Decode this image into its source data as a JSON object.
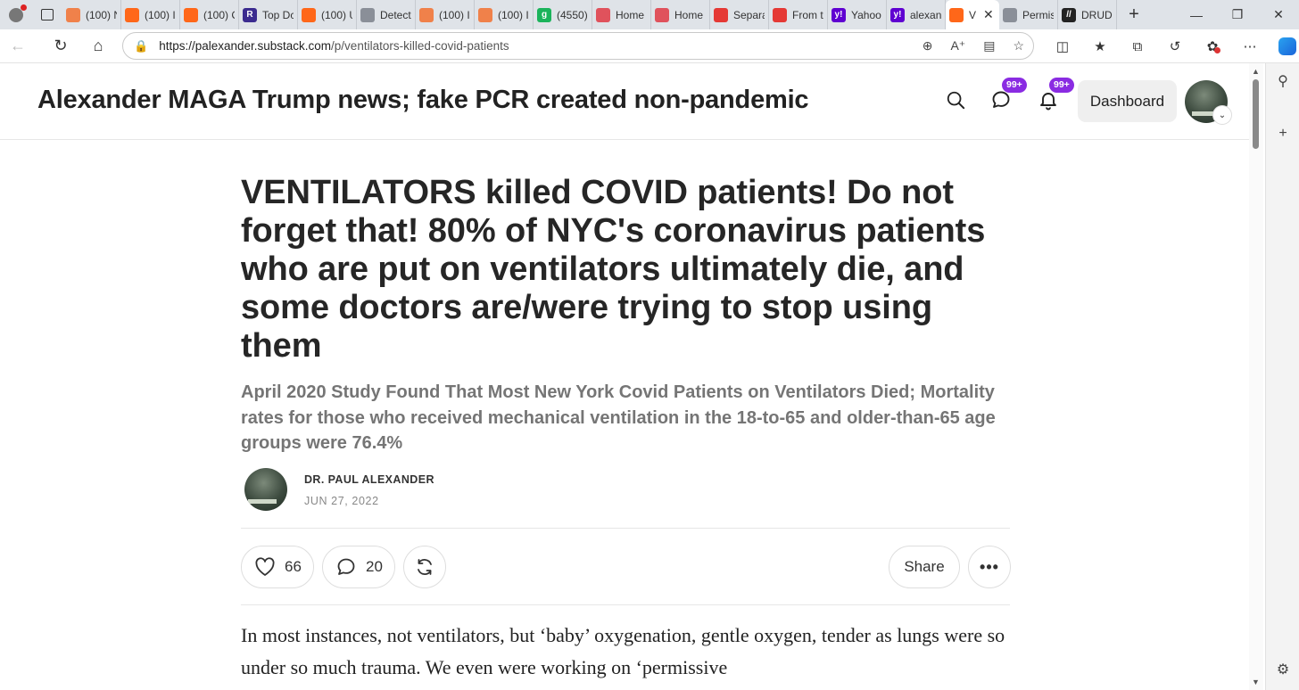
{
  "browser": {
    "tabs": [
      {
        "label": "(100) N",
        "color": "#f0814a",
        "glyph": ""
      },
      {
        "label": "(100) I",
        "color": "#ff6719",
        "glyph": ""
      },
      {
        "label": "(100) C",
        "color": "#ff6719",
        "glyph": ""
      },
      {
        "label": "Top Dc",
        "color": "#3b2b8f",
        "glyph": "R"
      },
      {
        "label": "(100) U",
        "color": "#ff6719",
        "glyph": ""
      },
      {
        "label": "Detect",
        "color": "#8a8f98",
        "glyph": ""
      },
      {
        "label": "(100) I",
        "color": "#f0814a",
        "glyph": ""
      },
      {
        "label": "(100) I",
        "color": "#f0814a",
        "glyph": ""
      },
      {
        "label": "(4550)",
        "color": "#1bb35b",
        "glyph": "g"
      },
      {
        "label": "Home",
        "color": "#e0525c",
        "glyph": ""
      },
      {
        "label": "Home",
        "color": "#e0525c",
        "glyph": ""
      },
      {
        "label": "Separa",
        "color": "#e53935",
        "glyph": ""
      },
      {
        "label": "From t",
        "color": "#e53935",
        "glyph": ""
      },
      {
        "label": "Yahoo",
        "color": "#5f01d1",
        "glyph": "y!"
      },
      {
        "label": "alexan",
        "color": "#5f01d1",
        "glyph": "y!"
      },
      {
        "label": "V",
        "color": "#ff6719",
        "glyph": "",
        "active": true
      },
      {
        "label": "Permis",
        "color": "#8a8f98",
        "glyph": ""
      },
      {
        "label": "DRUD",
        "color": "#222222",
        "glyph": "//"
      }
    ],
    "new_tab_label": "+",
    "url_host": "https://palexander.substack.com",
    "url_path": "/p/ventilators-killed-covid-patients"
  },
  "header": {
    "pub_title": "Alexander MAGA Trump news; fake PCR created non-pandemic",
    "chat_badge": "99+",
    "notif_badge": "99+",
    "dashboard_label": "Dashboard"
  },
  "post": {
    "title": "VENTILATORS killed COVID patients! Do not forget that! 80% of NYC's coronavirus patients who are put on ventilators ultimately die, and some doctors are/were trying to stop using them",
    "subtitle": "April 2020 Study Found That Most New York Covid Patients on Ventilators Died; Mortality rates for those who received mechanical ventilation in the 18-to-65 and older-than-65 age groups were 76.4%",
    "author": "DR. PAUL ALEXANDER",
    "date": "JUN 27, 2022",
    "likes": "66",
    "comments": "20",
    "share_label": "Share",
    "body": "In most instances, not ventilators, but ‘baby’ oxygenation, gentle oxygen, tender as lungs were so under so much trauma. We even were working on ‘permissive"
  },
  "colors": {
    "accent_badge": "#8a2be2",
    "brand": "#ff6719"
  }
}
